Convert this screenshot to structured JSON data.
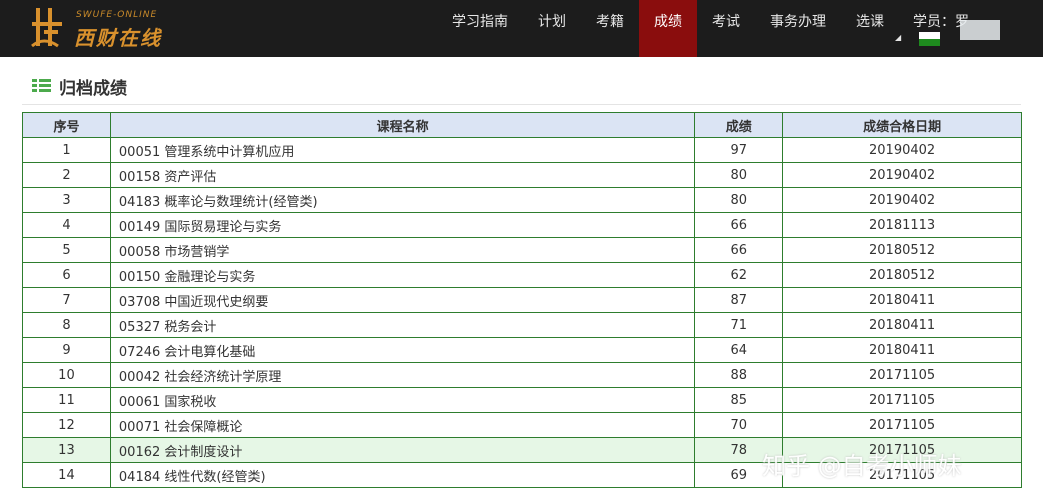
{
  "brand": {
    "tagline": "SWUFE-ONLINE",
    "name": "西财在线",
    "color": "#d9912d"
  },
  "nav": {
    "items": [
      {
        "label": "学习指南"
      },
      {
        "label": "计划"
      },
      {
        "label": "考籍"
      },
      {
        "label": "成绩",
        "active": true
      },
      {
        "label": "考试"
      },
      {
        "label": "事务办理"
      },
      {
        "label": "选课"
      }
    ],
    "active_color": "#8a0d0d",
    "user_label": "学员：罗"
  },
  "page": {
    "title": "归档成绩",
    "title_icon": "list-icon"
  },
  "table": {
    "headers": {
      "no": "序号",
      "name": "课程名称",
      "score": "成绩",
      "date": "成绩合格日期"
    },
    "rows": [
      {
        "no": "1",
        "name": "00051 管理系统中计算机应用",
        "score": "97",
        "date": "20190402"
      },
      {
        "no": "2",
        "name": "00158 资产评估",
        "score": "80",
        "date": "20190402"
      },
      {
        "no": "3",
        "name": "04183 概率论与数理统计(经管类)",
        "score": "80",
        "date": "20190402"
      },
      {
        "no": "4",
        "name": "00149 国际贸易理论与实务",
        "score": "66",
        "date": "20181113"
      },
      {
        "no": "5",
        "name": "00058 市场营销学",
        "score": "66",
        "date": "20180512"
      },
      {
        "no": "6",
        "name": "00150 金融理论与实务",
        "score": "62",
        "date": "20180512"
      },
      {
        "no": "7",
        "name": "03708 中国近现代史纲要",
        "score": "87",
        "date": "20180411"
      },
      {
        "no": "8",
        "name": "05327 税务会计",
        "score": "71",
        "date": "20180411"
      },
      {
        "no": "9",
        "name": "07246 会计电算化基础",
        "score": "64",
        "date": "20180411"
      },
      {
        "no": "10",
        "name": "00042 社会经济统计学原理",
        "score": "88",
        "date": "20171105"
      },
      {
        "no": "11",
        "name": "00061 国家税收",
        "score": "85",
        "date": "20171105"
      },
      {
        "no": "12",
        "name": "00071 社会保障概论",
        "score": "70",
        "date": "20171105"
      },
      {
        "no": "13",
        "name": "00162 会计制度设计",
        "score": "78",
        "date": "20171105",
        "highlighted": true
      },
      {
        "no": "14",
        "name": "04184 线性代数(经管类)",
        "score": "69",
        "date": "20171105"
      }
    ],
    "border_color": "#2e7d2e",
    "header_bg": "#dbe4f4",
    "highlight_bg": "#e6f7e6"
  },
  "watermark": "知乎 @自考小师妹"
}
